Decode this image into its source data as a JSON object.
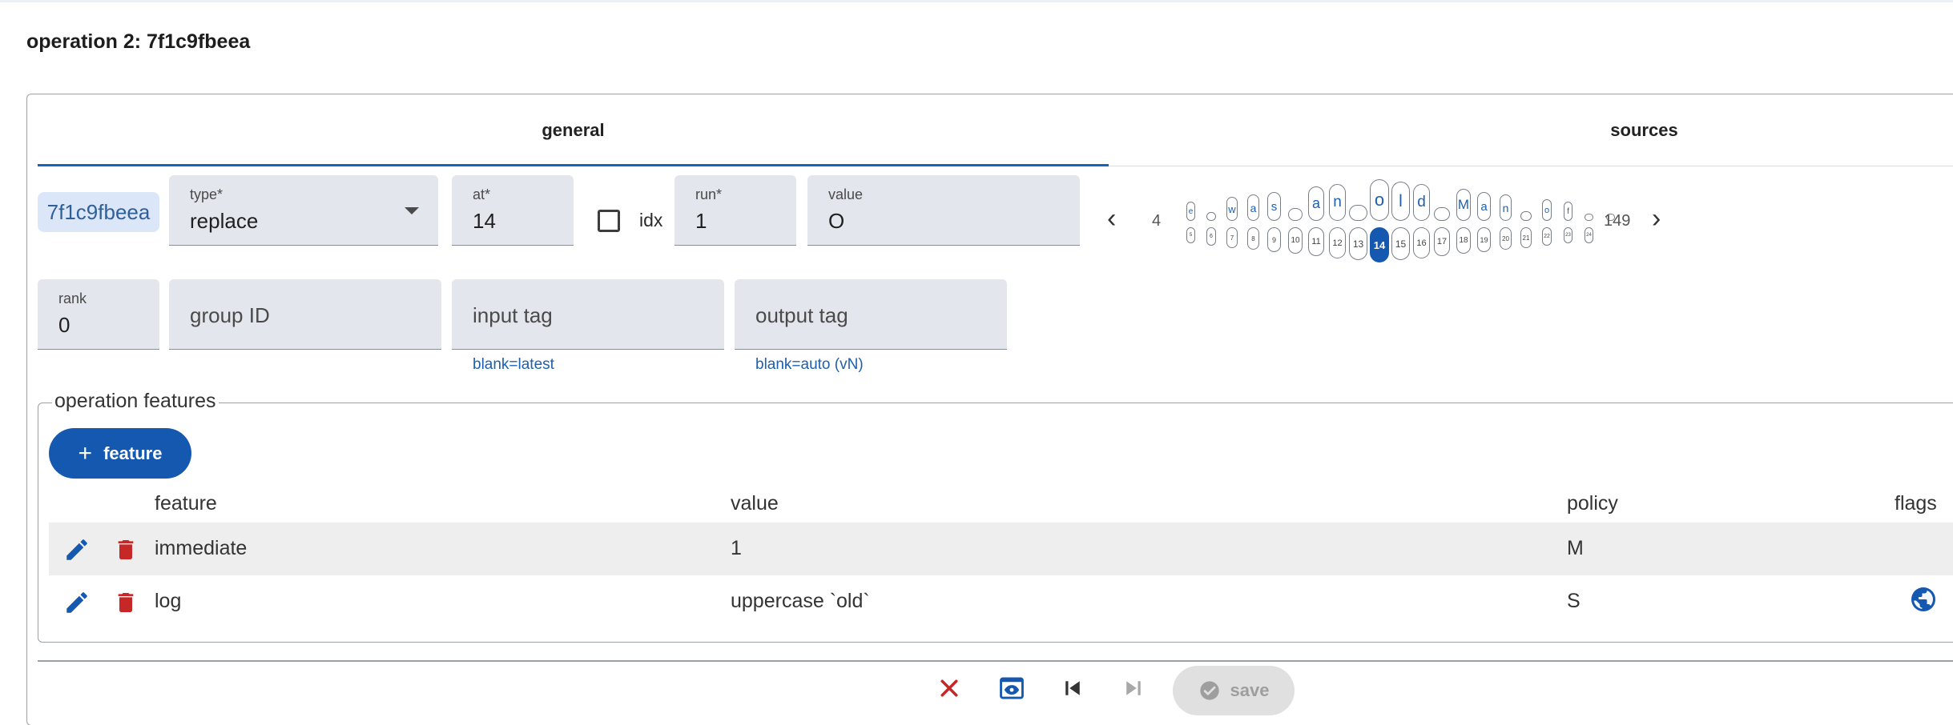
{
  "page": {
    "title": "operation 2: 7f1c9fbeea"
  },
  "tabs": [
    {
      "label": "general"
    },
    {
      "label": "sources"
    }
  ],
  "operation": {
    "id": "7f1c9fbeea",
    "type": {
      "label": "type*",
      "value": "replace"
    },
    "at": {
      "label": "at*",
      "value": "14"
    },
    "idx": {
      "label": "idx",
      "checked": false
    },
    "run": {
      "label": "run*",
      "value": "1"
    },
    "value": {
      "label": "value",
      "value": "O"
    },
    "rank": {
      "label": "rank",
      "value": "0"
    },
    "group_id": {
      "placeholder": "group ID"
    },
    "input_tag": {
      "placeholder": "input tag",
      "hint": "blank=latest"
    },
    "output_tag": {
      "placeholder": "output tag",
      "hint": "blank=auto (vN)"
    }
  },
  "token_browser": {
    "prev_count": "4",
    "next_count": "149",
    "chars": [
      "e",
      "",
      "w",
      "a",
      "s",
      "",
      "a",
      "n",
      "",
      "o",
      "l",
      "d",
      "",
      "M",
      "a",
      "n",
      "",
      "o",
      "f",
      "",
      ""
    ],
    "positions": [
      "5",
      "6",
      "7",
      "8",
      "9",
      "10",
      "11",
      "12",
      "13",
      "14",
      "15",
      "16",
      "17",
      "18",
      "19",
      "20",
      "21",
      "22",
      "23",
      "24"
    ],
    "selected_position": "14"
  },
  "features": {
    "legend": "operation features",
    "add_label": "feature",
    "columns": {
      "feature": "feature",
      "value": "value",
      "policy": "policy",
      "flags": "flags"
    },
    "rows": [
      {
        "feature": "immediate",
        "value": "1",
        "policy": "M",
        "flag_icon": ""
      },
      {
        "feature": "log",
        "value": "uppercase `old`",
        "policy": "S",
        "flag_icon": "globe-icon"
      }
    ]
  },
  "footer": {
    "save_label": "save"
  },
  "colors": {
    "accent": "#1558b0",
    "danger": "#c62828",
    "field_bg": "#e3e6ec"
  }
}
